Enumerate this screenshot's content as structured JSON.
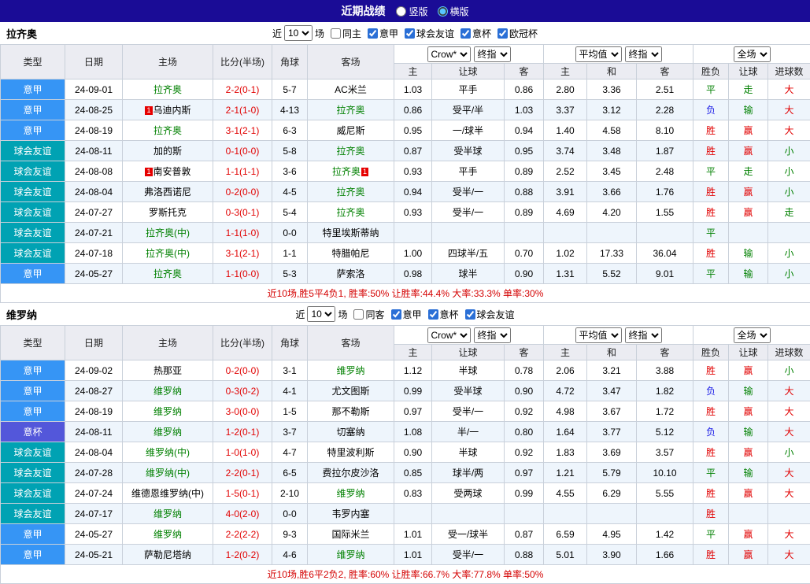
{
  "topbar": {
    "title": "近期战绩",
    "radios": [
      {
        "label": "竖版",
        "selected": false
      },
      {
        "label": "横版",
        "selected": true
      }
    ]
  },
  "table_header": {
    "static_cols": [
      "类型",
      "日期",
      "主场",
      "比分(半场)",
      "角球",
      "客场"
    ],
    "groups": [
      {
        "selects": [
          "Crow*",
          "终指"
        ],
        "cols": [
          "主",
          "让球",
          "客"
        ]
      },
      {
        "selects": [
          "平均值",
          "终指"
        ],
        "cols": [
          "主",
          "和",
          "客"
        ]
      },
      {
        "selects": [
          "全场"
        ],
        "cols": [
          "胜负",
          "让球",
          "进球数"
        ]
      }
    ]
  },
  "colors": {
    "topbar_bg": "#1a0c96",
    "league": {
      "意甲": "#3695f5",
      "球会友谊": "#00a2b3",
      "意杯": "#5357da"
    },
    "result": {
      "胜": "#e10000",
      "赢": "#e10000",
      "大": "#e10000",
      "平": "#008000",
      "输": "#008000",
      "走": "#008000",
      "小": "#008000",
      "负": "#1a1ae6"
    },
    "team_highlight": "#008000",
    "score": "#e10000",
    "summary": "#d40000"
  },
  "sections": [
    {
      "team": "拉齐奥",
      "filter": {
        "prefix": "近",
        "count": "10",
        "suffix": "场",
        "checkboxes": [
          {
            "label": "同主",
            "checked": false
          },
          {
            "label": "意甲",
            "checked": true
          },
          {
            "label": "球会友谊",
            "checked": true
          },
          {
            "label": "意杯",
            "checked": true
          },
          {
            "label": "欧冠杯",
            "checked": true
          }
        ]
      },
      "rows": [
        {
          "type": "意甲",
          "date": "24-09-01",
          "home": "拉齐奥",
          "home_hl": true,
          "home_card": "",
          "score": "2-2(0-1)",
          "corner": "5-7",
          "away": "AC米兰",
          "away_hl": false,
          "away_card": "",
          "o1": [
            "1.03",
            "平手",
            "0.86"
          ],
          "o2": [
            "2.80",
            "3.36",
            "2.51"
          ],
          "res": [
            "平",
            "走",
            "大"
          ]
        },
        {
          "type": "意甲",
          "date": "24-08-25",
          "home": "乌迪内斯",
          "home_hl": false,
          "home_card": "1",
          "score": "2-1(1-0)",
          "corner": "4-13",
          "away": "拉齐奥",
          "away_hl": true,
          "away_card": "",
          "o1": [
            "0.86",
            "受平/半",
            "1.03"
          ],
          "o2": [
            "3.37",
            "3.12",
            "2.28"
          ],
          "res": [
            "负",
            "输",
            "大"
          ]
        },
        {
          "type": "意甲",
          "date": "24-08-19",
          "home": "拉齐奥",
          "home_hl": true,
          "home_card": "",
          "score": "3-1(2-1)",
          "corner": "6-3",
          "away": "威尼斯",
          "away_hl": false,
          "away_card": "",
          "o1": [
            "0.95",
            "一/球半",
            "0.94"
          ],
          "o2": [
            "1.40",
            "4.58",
            "8.10"
          ],
          "res": [
            "胜",
            "赢",
            "大"
          ]
        },
        {
          "type": "球会友谊",
          "date": "24-08-11",
          "home": "加的斯",
          "home_hl": false,
          "home_card": "",
          "score": "0-1(0-0)",
          "corner": "5-8",
          "away": "拉齐奥",
          "away_hl": true,
          "away_card": "",
          "o1": [
            "0.87",
            "受半球",
            "0.95"
          ],
          "o2": [
            "3.74",
            "3.48",
            "1.87"
          ],
          "res": [
            "胜",
            "赢",
            "小"
          ]
        },
        {
          "type": "球会友谊",
          "date": "24-08-08",
          "home": "南安普敦",
          "home_hl": false,
          "home_card": "1",
          "score": "1-1(1-1)",
          "corner": "3-6",
          "away": "拉齐奥",
          "away_hl": true,
          "away_card": "1",
          "o1": [
            "0.93",
            "平手",
            "0.89"
          ],
          "o2": [
            "2.52",
            "3.45",
            "2.48"
          ],
          "res": [
            "平",
            "走",
            "小"
          ]
        },
        {
          "type": "球会友谊",
          "date": "24-08-04",
          "home": "弗洛西诺尼",
          "home_hl": false,
          "home_card": "",
          "score": "0-2(0-0)",
          "corner": "4-5",
          "away": "拉齐奥",
          "away_hl": true,
          "away_card": "",
          "o1": [
            "0.94",
            "受半/一",
            "0.88"
          ],
          "o2": [
            "3.91",
            "3.66",
            "1.76"
          ],
          "res": [
            "胜",
            "赢",
            "小"
          ]
        },
        {
          "type": "球会友谊",
          "date": "24-07-27",
          "home": "罗斯托克",
          "home_hl": false,
          "home_card": "",
          "score": "0-3(0-1)",
          "corner": "5-4",
          "away": "拉齐奥",
          "away_hl": true,
          "away_card": "",
          "o1": [
            "0.93",
            "受半/一",
            "0.89"
          ],
          "o2": [
            "4.69",
            "4.20",
            "1.55"
          ],
          "res": [
            "胜",
            "赢",
            "走"
          ]
        },
        {
          "type": "球会友谊",
          "date": "24-07-21",
          "home": "拉齐奥(中)",
          "home_hl": true,
          "home_card": "",
          "score": "1-1(1-0)",
          "corner": "0-0",
          "away": "特里埃斯蒂纳",
          "away_hl": false,
          "away_card": "",
          "o1": [
            "",
            "",
            ""
          ],
          "o2": [
            "",
            "",
            ""
          ],
          "res": [
            "平",
            "",
            ""
          ]
        },
        {
          "type": "球会友谊",
          "date": "24-07-18",
          "home": "拉齐奥(中)",
          "home_hl": true,
          "home_card": "",
          "score": "3-1(2-1)",
          "corner": "1-1",
          "away": "特腊帕尼",
          "away_hl": false,
          "away_card": "",
          "o1": [
            "1.00",
            "四球半/五",
            "0.70"
          ],
          "o2": [
            "1.02",
            "17.33",
            "36.04"
          ],
          "res": [
            "胜",
            "输",
            "小"
          ]
        },
        {
          "type": "意甲",
          "date": "24-05-27",
          "home": "拉齐奥",
          "home_hl": true,
          "home_card": "",
          "score": "1-1(0-0)",
          "corner": "5-3",
          "away": "萨索洛",
          "away_hl": false,
          "away_card": "",
          "o1": [
            "0.98",
            "球半",
            "0.90"
          ],
          "o2": [
            "1.31",
            "5.52",
            "9.01"
          ],
          "res": [
            "平",
            "输",
            "小"
          ]
        }
      ],
      "summary": "近10场,胜5平4负1, 胜率:50% 让胜率:44.4% 大率:33.3% 单率:30%"
    },
    {
      "team": "维罗纳",
      "filter": {
        "prefix": "近",
        "count": "10",
        "suffix": "场",
        "checkboxes": [
          {
            "label": "同客",
            "checked": false
          },
          {
            "label": "意甲",
            "checked": true
          },
          {
            "label": "意杯",
            "checked": true
          },
          {
            "label": "球会友谊",
            "checked": true
          }
        ]
      },
      "rows": [
        {
          "type": "意甲",
          "date": "24-09-02",
          "home": "热那亚",
          "home_hl": false,
          "home_card": "",
          "score": "0-2(0-0)",
          "corner": "3-1",
          "away": "维罗纳",
          "away_hl": true,
          "away_card": "",
          "o1": [
            "1.12",
            "半球",
            "0.78"
          ],
          "o2": [
            "2.06",
            "3.21",
            "3.88"
          ],
          "res": [
            "胜",
            "赢",
            "小"
          ]
        },
        {
          "type": "意甲",
          "date": "24-08-27",
          "home": "维罗纳",
          "home_hl": true,
          "home_card": "",
          "score": "0-3(0-2)",
          "corner": "4-1",
          "away": "尤文图斯",
          "away_hl": false,
          "away_card": "",
          "o1": [
            "0.99",
            "受半球",
            "0.90"
          ],
          "o2": [
            "4.72",
            "3.47",
            "1.82"
          ],
          "res": [
            "负",
            "输",
            "大"
          ]
        },
        {
          "type": "意甲",
          "date": "24-08-19",
          "home": "维罗纳",
          "home_hl": true,
          "home_card": "",
          "score": "3-0(0-0)",
          "corner": "1-5",
          "away": "那不勒斯",
          "away_hl": false,
          "away_card": "",
          "o1": [
            "0.97",
            "受半/一",
            "0.92"
          ],
          "o2": [
            "4.98",
            "3.67",
            "1.72"
          ],
          "res": [
            "胜",
            "赢",
            "大"
          ]
        },
        {
          "type": "意杯",
          "date": "24-08-11",
          "home": "维罗纳",
          "home_hl": true,
          "home_card": "",
          "score": "1-2(0-1)",
          "corner": "3-7",
          "away": "切塞纳",
          "away_hl": false,
          "away_card": "",
          "o1": [
            "1.08",
            "半/一",
            "0.80"
          ],
          "o2": [
            "1.64",
            "3.77",
            "5.12"
          ],
          "res": [
            "负",
            "输",
            "大"
          ]
        },
        {
          "type": "球会友谊",
          "date": "24-08-04",
          "home": "维罗纳(中)",
          "home_hl": true,
          "home_card": "",
          "score": "1-0(1-0)",
          "corner": "4-7",
          "away": "特里波利斯",
          "away_hl": false,
          "away_card": "",
          "o1": [
            "0.90",
            "半球",
            "0.92"
          ],
          "o2": [
            "1.83",
            "3.69",
            "3.57"
          ],
          "res": [
            "胜",
            "赢",
            "小"
          ]
        },
        {
          "type": "球会友谊",
          "date": "24-07-28",
          "home": "维罗纳(中)",
          "home_hl": true,
          "home_card": "",
          "score": "2-2(0-1)",
          "corner": "6-5",
          "away": "费拉尔皮沙洛",
          "away_hl": false,
          "away_card": "",
          "o1": [
            "0.85",
            "球半/两",
            "0.97"
          ],
          "o2": [
            "1.21",
            "5.79",
            "10.10"
          ],
          "res": [
            "平",
            "输",
            "大"
          ]
        },
        {
          "type": "球会友谊",
          "date": "24-07-24",
          "home": "维德恩维罗纳(中)",
          "home_hl": false,
          "home_card": "",
          "score": "1-5(0-1)",
          "corner": "2-10",
          "away": "维罗纳",
          "away_hl": true,
          "away_card": "",
          "o1": [
            "0.83",
            "受两球",
            "0.99"
          ],
          "o2": [
            "4.55",
            "6.29",
            "5.55"
          ],
          "res": [
            "胜",
            "赢",
            "大"
          ]
        },
        {
          "type": "球会友谊",
          "date": "24-07-17",
          "home": "维罗纳",
          "home_hl": true,
          "home_card": "",
          "score": "4-0(2-0)",
          "corner": "0-0",
          "away": "韦罗内塞",
          "away_hl": false,
          "away_card": "",
          "o1": [
            "",
            "",
            ""
          ],
          "o2": [
            "",
            "",
            ""
          ],
          "res": [
            "胜",
            "",
            ""
          ]
        },
        {
          "type": "意甲",
          "date": "24-05-27",
          "home": "维罗纳",
          "home_hl": true,
          "home_card": "",
          "score": "2-2(2-2)",
          "corner": "9-3",
          "away": "国际米兰",
          "away_hl": false,
          "away_card": "",
          "o1": [
            "1.01",
            "受一/球半",
            "0.87"
          ],
          "o2": [
            "6.59",
            "4.95",
            "1.42"
          ],
          "res": [
            "平",
            "赢",
            "大"
          ]
        },
        {
          "type": "意甲",
          "date": "24-05-21",
          "home": "萨勒尼塔纳",
          "home_hl": false,
          "home_card": "",
          "score": "1-2(0-2)",
          "corner": "4-6",
          "away": "维罗纳",
          "away_hl": true,
          "away_card": "",
          "o1": [
            "1.01",
            "受半/一",
            "0.88"
          ],
          "o2": [
            "5.01",
            "3.90",
            "1.66"
          ],
          "res": [
            "胜",
            "赢",
            "大"
          ]
        }
      ],
      "summary": "近10场,胜6平2负2, 胜率:60% 让胜率:66.7% 大率:77.8% 单率:50%"
    }
  ]
}
